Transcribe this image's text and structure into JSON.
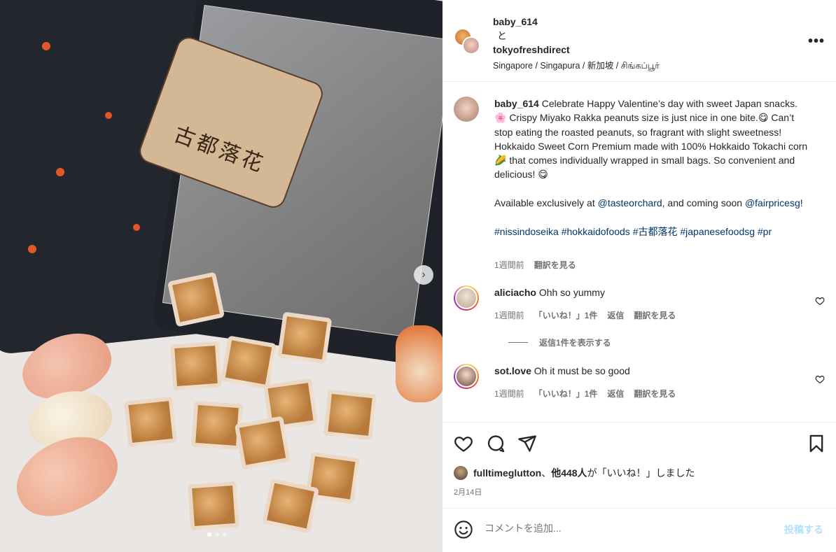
{
  "photo": {
    "label_text": "古都落花",
    "carousel_count": 3,
    "carousel_active": 0
  },
  "header": {
    "author": "baby_614",
    "and_text": "と",
    "collab": "tokyofreshdirect",
    "location": "Singapore / Singapura / 新加坡 / சிங்கப்பூர்",
    "more_icon": "more-horizontal-icon"
  },
  "caption": {
    "username": "baby_614",
    "text_p1": "Celebrate Happy Valentine’s day with sweet Japan snacks. 🌸 Crispy Miyako Rakka peanuts size is just nice in one bite.😋 Can’t stop eating the roasted peanuts, so fragrant with slight sweetness! Hokkaido Sweet Corn Premium made with 100% Hokkaido Tokachi corn 🌽 that comes individually wrapped in small bags. So convenient and delicious! 😋",
    "text_p2_a": "Available exclusively at ",
    "mention1": "@tasteorchard",
    "text_p2_b": ", and coming soon ",
    "mention2": "@fairpricesg",
    "text_p2_c": "!",
    "hashtags": "#nissindoseika #hokkaidofoods #古都落花 #japanesefoodsg #pr",
    "time": "1週間前",
    "translate": "翻訳を見る"
  },
  "comments": [
    {
      "username": "aliciacho",
      "text": "Ohh so yummy",
      "time": "1週間前",
      "likes": "「いいね！」1件",
      "reply": "返信",
      "translate": "翻訳を見る",
      "view_replies": "返信1件を表示する"
    },
    {
      "username": "sot.love",
      "text": "Oh it must be so good",
      "time": "1週間前",
      "likes": "「いいね！」1件",
      "reply": "返信",
      "translate": "翻訳を見る"
    }
  ],
  "likes_line": {
    "user": "fulltimeglutton",
    "middle": "、",
    "others": "他448人",
    "suffix": "が「いいね！」しました"
  },
  "date": "2月14日",
  "add_comment": {
    "placeholder": "コメントを追加...",
    "post_label": "投稿する"
  },
  "colors": {
    "link": "#00376b",
    "meta": "#737373",
    "post_disabled": "#b2dffc"
  }
}
